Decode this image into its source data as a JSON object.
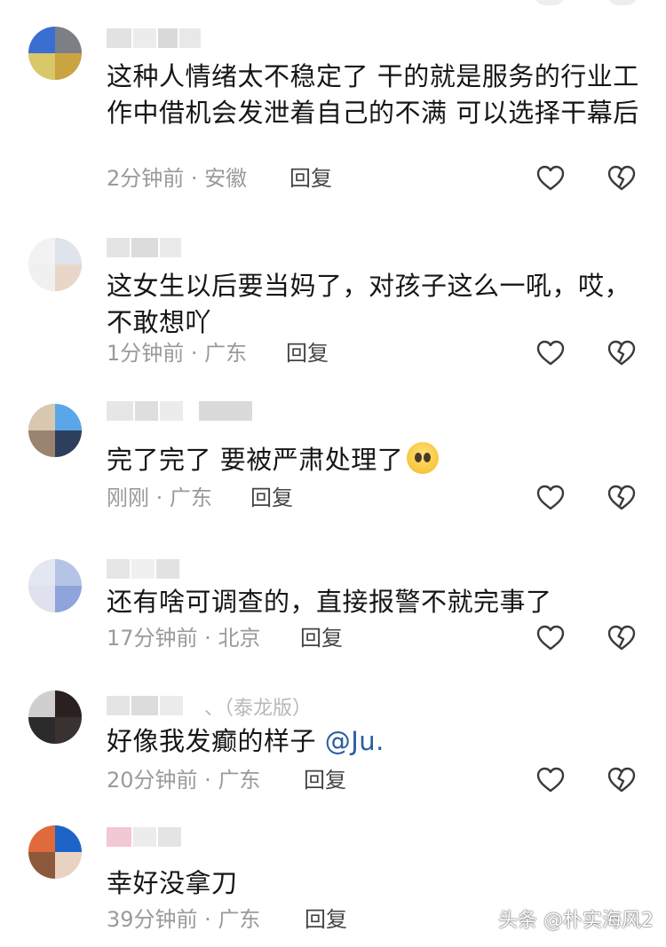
{
  "comments": [
    {
      "text": "这种人情绪太不稳定了  干的就是服务的行业工作中借机会发泄着自己的不满  可以选择干幕后",
      "time": "2分钟前",
      "location": "安徽",
      "reply": "回复"
    },
    {
      "text": "这女生以后要当妈了，对孩子这么一吼，哎，不敢想吖",
      "time": "1分钟前",
      "location": "广东",
      "reply": "回复"
    },
    {
      "text": "完了完了  要被严肃处理了",
      "emoji": "pleading-face-emoji",
      "time": "刚刚",
      "location": "广东",
      "reply": "回复"
    },
    {
      "text": "还有啥可调查的，直接报警不就完事了",
      "time": "17分钟前",
      "location": "北京",
      "reply": "回复"
    },
    {
      "text": "好像我发癫的样子",
      "mention": "@Ju.",
      "name_hint": "、（泰龙版）",
      "time": "20分钟前",
      "location": "广东",
      "reply": "回复"
    },
    {
      "text": "幸好没拿刀",
      "time": "39分钟前",
      "location": "广东",
      "reply": "回复"
    }
  ],
  "icons": {
    "like": "heart-outline-icon",
    "dislike": "broken-heart-icon"
  },
  "watermark": "头条 @朴实海风2",
  "colors": {
    "text": "#161616",
    "meta": "#9a9a9a",
    "mention": "#2b5c9e",
    "icon": "#3a3a3a"
  }
}
